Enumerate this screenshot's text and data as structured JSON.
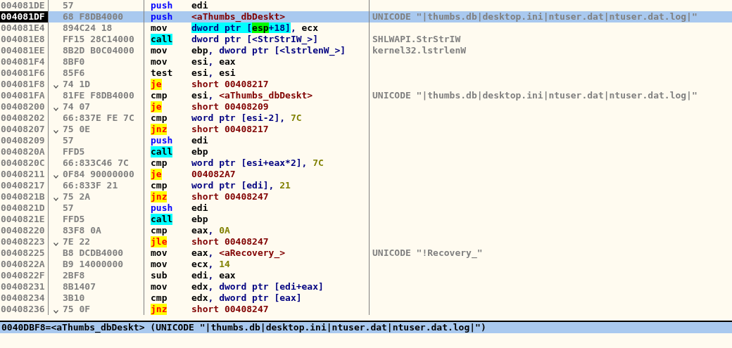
{
  "rows": [
    {
      "address": "004081DE",
      "bytes": "57",
      "mnemonic": "push",
      "kind": "push",
      "selected": false,
      "current": false,
      "operand": [
        {
          "kind": "reg",
          "text": "edi"
        }
      ]
    },
    {
      "address": "004081DF",
      "bytes": "68 F8DB4000",
      "mnemonic": "push",
      "kind": "push",
      "selected": true,
      "current": true,
      "operand": [
        {
          "kind": "label",
          "text": "<aThumbs_dbDeskt>"
        }
      ],
      "comment": "UNICODE \"|thumbs.db|desktop.ini|ntuser.dat|ntuser.dat.log|\""
    },
    {
      "address": "004081E4",
      "bytes": "894C24 18",
      "mnemonic": "mov",
      "kind": "plain",
      "selected": false,
      "current": false,
      "operand": [
        {
          "kind": "mem_hi",
          "text": "dword ptr ["
        },
        {
          "kind": "reg_hi",
          "text": "esp"
        },
        {
          "kind": "mem_hi",
          "text": "+18]"
        },
        {
          "kind": "sep",
          "text": ", "
        },
        {
          "kind": "reg",
          "text": "ecx"
        }
      ]
    },
    {
      "address": "004081E8",
      "bytes": "FF15 28C14000",
      "mnemonic": "call",
      "kind": "call",
      "selected": false,
      "current": false,
      "operand": [
        {
          "kind": "mem",
          "text": "dword ptr [<StrStrIW_>]"
        }
      ],
      "comment": "SHLWAPI.StrStrIW"
    },
    {
      "address": "004081EE",
      "bytes": "8B2D B0C04000",
      "mnemonic": "mov",
      "kind": "plain",
      "selected": false,
      "current": false,
      "operand": [
        {
          "kind": "reg",
          "text": "ebp"
        },
        {
          "kind": "sep",
          "text": ", "
        },
        {
          "kind": "mem",
          "text": "dword ptr [<lstrlenW_>]"
        }
      ],
      "comment": "kernel32.lstrlenW"
    },
    {
      "address": "004081F4",
      "bytes": "8BF0",
      "mnemonic": "mov",
      "kind": "plain",
      "selected": false,
      "current": false,
      "operand": [
        {
          "kind": "reg",
          "text": "esi"
        },
        {
          "kind": "sep",
          "text": ", "
        },
        {
          "kind": "reg",
          "text": "eax"
        }
      ]
    },
    {
      "address": "004081F6",
      "bytes": "85F6",
      "mnemonic": "test",
      "kind": "plain",
      "selected": false,
      "current": false,
      "operand": [
        {
          "kind": "reg",
          "text": "esi"
        },
        {
          "kind": "sep",
          "text": ", "
        },
        {
          "kind": "reg",
          "text": "esi"
        }
      ]
    },
    {
      "address": "004081F8",
      "bytes": "74 1D",
      "mnemonic": "je",
      "kind": "jump",
      "selected": false,
      "current": false,
      "operand": [
        {
          "kind": "label",
          "text": "short 00408217"
        }
      ]
    },
    {
      "address": "004081FA",
      "bytes": "81FE F8DB4000",
      "mnemonic": "cmp",
      "kind": "plain",
      "selected": false,
      "current": false,
      "operand": [
        {
          "kind": "reg",
          "text": "esi"
        },
        {
          "kind": "sep",
          "text": ", "
        },
        {
          "kind": "label",
          "text": "<aThumbs_dbDeskt>"
        }
      ],
      "comment": "UNICODE \"|thumbs.db|desktop.ini|ntuser.dat|ntuser.dat.log|\""
    },
    {
      "address": "00408200",
      "bytes": "74 07",
      "mnemonic": "je",
      "kind": "jump",
      "selected": false,
      "current": false,
      "operand": [
        {
          "kind": "label",
          "text": "short 00408209"
        }
      ]
    },
    {
      "address": "00408202",
      "bytes": "66:837E FE 7C",
      "mnemonic": "cmp",
      "kind": "plain",
      "selected": false,
      "current": false,
      "operand": [
        {
          "kind": "mem",
          "text": "word ptr [esi-2]"
        },
        {
          "kind": "sep",
          "text": ", "
        },
        {
          "kind": "imm",
          "text": "7C"
        }
      ]
    },
    {
      "address": "00408207",
      "bytes": "75 0E",
      "mnemonic": "jnz",
      "kind": "jump",
      "selected": false,
      "current": false,
      "operand": [
        {
          "kind": "label",
          "text": "short 00408217"
        }
      ]
    },
    {
      "address": "00408209",
      "bytes": "57",
      "mnemonic": "push",
      "kind": "push",
      "selected": false,
      "current": false,
      "operand": [
        {
          "kind": "reg",
          "text": "edi"
        }
      ]
    },
    {
      "address": "0040820A",
      "bytes": "FFD5",
      "mnemonic": "call",
      "kind": "call",
      "selected": false,
      "current": false,
      "operand": [
        {
          "kind": "reg",
          "text": "ebp"
        }
      ]
    },
    {
      "address": "0040820C",
      "bytes": "66:833C46 7C",
      "mnemonic": "cmp",
      "kind": "plain",
      "selected": false,
      "current": false,
      "operand": [
        {
          "kind": "mem",
          "text": "word ptr [esi+eax*2]"
        },
        {
          "kind": "sep",
          "text": ", "
        },
        {
          "kind": "imm",
          "text": "7C"
        }
      ]
    },
    {
      "address": "00408211",
      "bytes": "0F84 90000000",
      "mnemonic": "je",
      "kind": "jump",
      "selected": false,
      "current": false,
      "operand": [
        {
          "kind": "label",
          "text": "004082A7"
        }
      ]
    },
    {
      "address": "00408217",
      "bytes": "66:833F 21",
      "mnemonic": "cmp",
      "kind": "plain",
      "selected": false,
      "current": false,
      "operand": [
        {
          "kind": "mem",
          "text": "word ptr [edi]"
        },
        {
          "kind": "sep",
          "text": ", "
        },
        {
          "kind": "imm",
          "text": "21"
        }
      ]
    },
    {
      "address": "0040821B",
      "bytes": "75 2A",
      "mnemonic": "jnz",
      "kind": "jump",
      "selected": false,
      "current": false,
      "operand": [
        {
          "kind": "label",
          "text": "short 00408247"
        }
      ]
    },
    {
      "address": "0040821D",
      "bytes": "57",
      "mnemonic": "push",
      "kind": "push",
      "selected": false,
      "current": false,
      "operand": [
        {
          "kind": "reg",
          "text": "edi"
        }
      ]
    },
    {
      "address": "0040821E",
      "bytes": "FFD5",
      "mnemonic": "call",
      "kind": "call",
      "selected": false,
      "current": false,
      "operand": [
        {
          "kind": "reg",
          "text": "ebp"
        }
      ]
    },
    {
      "address": "00408220",
      "bytes": "83F8 0A",
      "mnemonic": "cmp",
      "kind": "plain",
      "selected": false,
      "current": false,
      "operand": [
        {
          "kind": "reg",
          "text": "eax"
        },
        {
          "kind": "sep",
          "text": ", "
        },
        {
          "kind": "imm",
          "text": "0A"
        }
      ]
    },
    {
      "address": "00408223",
      "bytes": "7E 22",
      "mnemonic": "jle",
      "kind": "jump",
      "selected": false,
      "current": false,
      "operand": [
        {
          "kind": "label",
          "text": "short 00408247"
        }
      ]
    },
    {
      "address": "00408225",
      "bytes": "B8 DCDB4000",
      "mnemonic": "mov",
      "kind": "plain",
      "selected": false,
      "current": false,
      "operand": [
        {
          "kind": "reg",
          "text": "eax"
        },
        {
          "kind": "sep",
          "text": ", "
        },
        {
          "kind": "label",
          "text": "<aRecovery_>"
        }
      ],
      "comment": "UNICODE \"!Recovery_\""
    },
    {
      "address": "0040822A",
      "bytes": "B9 14000000",
      "mnemonic": "mov",
      "kind": "plain",
      "selected": false,
      "current": false,
      "operand": [
        {
          "kind": "reg",
          "text": "ecx"
        },
        {
          "kind": "sep",
          "text": ", "
        },
        {
          "kind": "imm",
          "text": "14"
        }
      ]
    },
    {
      "address": "0040822F",
      "bytes": "2BF8",
      "mnemonic": "sub",
      "kind": "plain",
      "selected": false,
      "current": false,
      "operand": [
        {
          "kind": "reg",
          "text": "edi"
        },
        {
          "kind": "sep",
          "text": ", "
        },
        {
          "kind": "reg",
          "text": "eax"
        }
      ]
    },
    {
      "address": "00408231",
      "bytes": "8B1407",
      "mnemonic": "mov",
      "kind": "plain",
      "selected": false,
      "current": false,
      "operand": [
        {
          "kind": "reg",
          "text": "edx"
        },
        {
          "kind": "sep",
          "text": ", "
        },
        {
          "kind": "mem",
          "text": "dword ptr [edi+eax]"
        }
      ]
    },
    {
      "address": "00408234",
      "bytes": "3B10",
      "mnemonic": "cmp",
      "kind": "plain",
      "selected": false,
      "current": false,
      "operand": [
        {
          "kind": "reg",
          "text": "edx"
        },
        {
          "kind": "sep",
          "text": ", "
        },
        {
          "kind": "mem",
          "text": "dword ptr [eax]"
        }
      ]
    },
    {
      "address": "00408236",
      "bytes": "75 0F",
      "mnemonic": "jnz",
      "kind": "jump",
      "selected": false,
      "current": false,
      "operand": [
        {
          "kind": "label",
          "text": "short 00408247"
        }
      ]
    }
  ],
  "status_bar": "0040DBF8=<aThumbs_dbDeskt> (UNICODE \"|thumbs.db|desktop.ini|ntuser.dat|ntuser.dat.log|\")"
}
